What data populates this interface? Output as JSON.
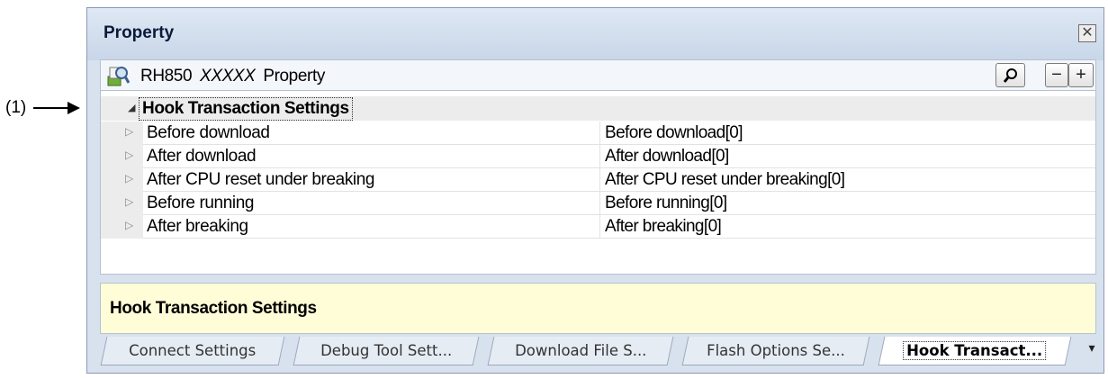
{
  "callout": {
    "label": "(1)"
  },
  "panel": {
    "title": "Property",
    "close_glyph": "✕"
  },
  "toolbar": {
    "prefix": "RH850",
    "device": "XXXXX",
    "suffix": "Property",
    "buttons": {
      "search": "⌕",
      "collapse": "−",
      "expand": "+"
    }
  },
  "category": {
    "toggle": "◢",
    "label": "Hook Transaction Settings"
  },
  "properties": [
    {
      "name": "Before download",
      "value": "Before download[0]"
    },
    {
      "name": "After download",
      "value": "After download[0]"
    },
    {
      "name": "After CPU reset under breaking",
      "value": "After CPU reset under breaking[0]"
    },
    {
      "name": "Before running",
      "value": "Before running[0]"
    },
    {
      "name": "After breaking",
      "value": "After breaking[0]"
    }
  ],
  "expander_glyph": "▷",
  "description": {
    "text": "Hook Transaction Settings"
  },
  "tabs": [
    {
      "label": "Connect Settings"
    },
    {
      "label": "Debug Tool Sett..."
    },
    {
      "label": "Download File S..."
    },
    {
      "label": "Flash Options Se..."
    },
    {
      "label": "Hook Transact..."
    }
  ],
  "tab_menu_glyph": "▾",
  "icons": {
    "property": "property-icon",
    "close": "close-icon",
    "search": "search-icon",
    "collapse": "collapse-icon",
    "expand": "expand-icon",
    "arrow": "arrow-right-icon"
  },
  "colors": {
    "panel_bg": "#d8e2ef",
    "description_bg": "#fffcd8",
    "category_bg": "#ececec",
    "active_tab_bg": "#ffffff"
  }
}
